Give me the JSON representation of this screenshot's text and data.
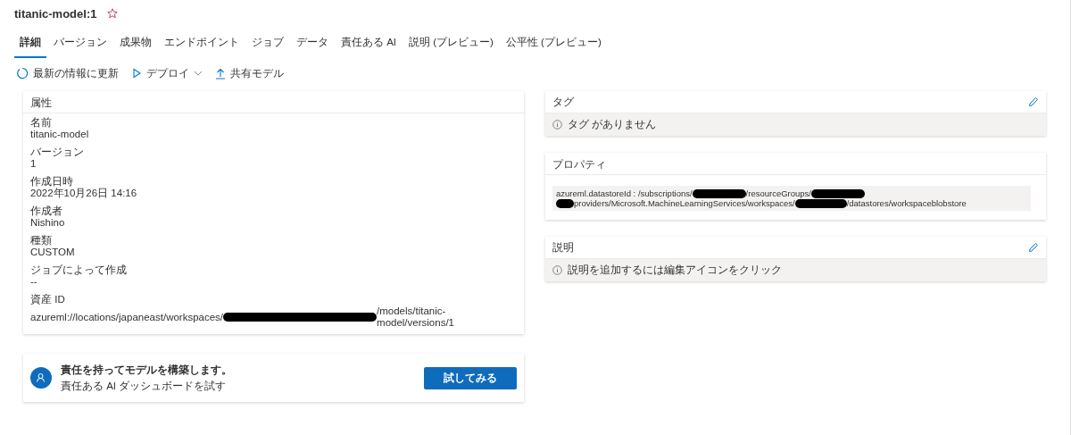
{
  "header": {
    "title": "titanic-model:1",
    "favorite": false
  },
  "tabs": [
    {
      "label": "詳細",
      "selected": true
    },
    {
      "label": "バージョン",
      "selected": false
    },
    {
      "label": "成果物",
      "selected": false
    },
    {
      "label": "エンドポイント",
      "selected": false
    },
    {
      "label": "ジョブ",
      "selected": false
    },
    {
      "label": "データ",
      "selected": false
    },
    {
      "label": "責任ある AI",
      "selected": false
    },
    {
      "label": "説明 (プレビュー)",
      "selected": false
    },
    {
      "label": "公平性 (プレビュー)",
      "selected": false
    }
  ],
  "toolbar": [
    {
      "kind": "refresh",
      "label": "最新の情報に更新"
    },
    {
      "kind": "deploy",
      "label": "デプロイ"
    },
    {
      "kind": "share",
      "label": "共有モデル"
    }
  ],
  "attributes": {
    "title": "属性",
    "fields": [
      {
        "label": "名前",
        "value": [
          {
            "kind": "text",
            "text": "titanic-model"
          }
        ]
      },
      {
        "label": "バージョン",
        "value": [
          {
            "kind": "text",
            "text": "1"
          }
        ]
      },
      {
        "label": "作成日時",
        "value": [
          {
            "kind": "text",
            "text": "2022年10月26日 14:16"
          }
        ]
      },
      {
        "label": "作成者",
        "value": [
          {
            "kind": "text",
            "text": "Nishino"
          }
        ]
      },
      {
        "label": "種類",
        "value": [
          {
            "kind": "text",
            "text": "CUSTOM"
          }
        ]
      },
      {
        "label": "ジョブによって作成",
        "value": [
          {
            "kind": "text",
            "text": "--"
          }
        ]
      },
      {
        "label": "資産 ID",
        "value": [
          {
            "kind": "text",
            "text": "azureml://locations/japaneast/workspaces/"
          },
          {
            "kind": "redacted"
          },
          {
            "kind": "text",
            "text": "/models/titanic-model/versions/1"
          }
        ]
      }
    ]
  },
  "promo": {
    "title": "責任を持ってモデルを構築します。",
    "subtitle": "責任ある AI ダッシュボードを試す",
    "button": "試してみる"
  },
  "tags": {
    "title": "タグ",
    "empty": "タグ がありません"
  },
  "properties": {
    "title": "プロパティ",
    "lines": [
      [
        {
          "kind": "text",
          "text": "azureml.datastoreId : /subscriptions/"
        },
        {
          "kind": "redacted"
        },
        {
          "kind": "text",
          "text": "/resourceGroups/"
        },
        {
          "kind": "redacted"
        }
      ],
      [
        {
          "kind": "redacted"
        },
        {
          "kind": "text",
          "text": "providers/Microsoft.MachineLearningServices/workspaces/"
        },
        {
          "kind": "redacted"
        },
        {
          "kind": "text",
          "text": "/datastores/workspaceblobstore"
        }
      ]
    ]
  },
  "description": {
    "title": "説明",
    "empty": "説明を追加するには編集アイコンをクリック"
  }
}
